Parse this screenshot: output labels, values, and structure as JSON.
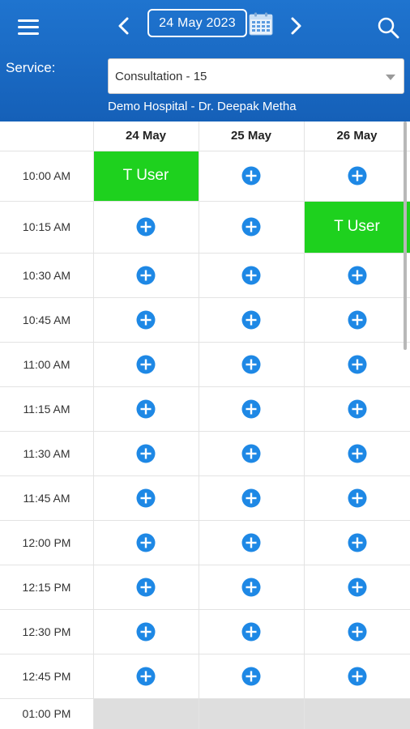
{
  "header": {
    "date": "24 May 2023",
    "service_label": "Service:",
    "service_value": "Consultation - 15",
    "doctor": "Demo Hospital - Dr. Deepak Metha"
  },
  "days": [
    "24 May",
    "25 May",
    "26 May"
  ],
  "slots": [
    {
      "time": "10:00 AM",
      "cells": [
        "T User",
        "+",
        "+"
      ]
    },
    {
      "time": "10:15 AM",
      "cells": [
        "+",
        "+",
        "T User"
      ]
    },
    {
      "time": "10:30 AM",
      "cells": [
        "+",
        "+",
        "+"
      ]
    },
    {
      "time": "10:45 AM",
      "cells": [
        "+",
        "+",
        "+"
      ]
    },
    {
      "time": "11:00 AM",
      "cells": [
        "+",
        "+",
        "+"
      ]
    },
    {
      "time": "11:15 AM",
      "cells": [
        "+",
        "+",
        "+"
      ]
    },
    {
      "time": "11:30 AM",
      "cells": [
        "+",
        "+",
        "+"
      ]
    },
    {
      "time": "11:45 AM",
      "cells": [
        "+",
        "+",
        "+"
      ]
    },
    {
      "time": "12:00 PM",
      "cells": [
        "+",
        "+",
        "+"
      ]
    },
    {
      "time": "12:15 PM",
      "cells": [
        "+",
        "+",
        "+"
      ]
    },
    {
      "time": "12:30 PM",
      "cells": [
        "+",
        "+",
        "+"
      ]
    },
    {
      "time": "12:45 PM",
      "cells": [
        "+",
        "+",
        "+"
      ]
    },
    {
      "time": "01:00 PM",
      "cells": [
        "",
        "",
        ""
      ]
    }
  ],
  "colors": {
    "header_blue": "#1a6cc6",
    "booked_green": "#1ed11e",
    "add_blue": "#1e88e5",
    "unavailable_grey": "#dedede"
  },
  "icons": [
    "menu-icon",
    "chevron-left-icon",
    "calendar-icon",
    "chevron-right-icon",
    "search-icon",
    "add-circle-icon",
    "dropdown-caret-icon"
  ]
}
